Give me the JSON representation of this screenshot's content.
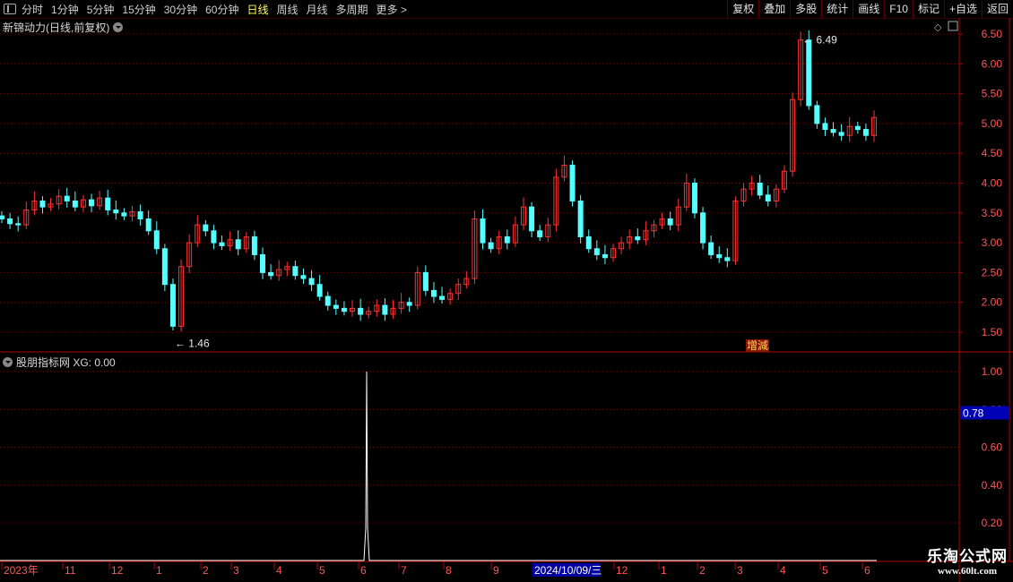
{
  "toolbar": {
    "periods": [
      "分时",
      "1分钟",
      "5分钟",
      "15分钟",
      "30分钟",
      "60分钟",
      "日线",
      "周线",
      "月线",
      "多周期",
      "更多 >"
    ],
    "active_period": "日线",
    "buttons": [
      "复权",
      "叠加",
      "多股",
      "统计",
      "画线",
      "F10",
      "标记",
      "+自选",
      "返回"
    ]
  },
  "main_pane": {
    "title": "新锦动力(日线,前复权)",
    "high_label": "6.49",
    "low_label": "1.46",
    "event_tag": "增減",
    "y_ticks": [
      "6.50",
      "6.00",
      "5.50",
      "5.00",
      "4.50",
      "4.00",
      "3.50",
      "3.00",
      "2.50",
      "2.00",
      "1.50"
    ]
  },
  "indicator_pane": {
    "title": "股朋指标网 XG: 0.00",
    "y_ticks": [
      "1.00",
      "0.80",
      "0.60",
      "0.40",
      "0.20"
    ],
    "current_value": "0.78"
  },
  "x_axis": {
    "labels": [
      "2023年",
      "11",
      "12",
      "1",
      "2",
      "3",
      "4",
      "5",
      "6",
      "7",
      "8",
      "9",
      "2024/10/09/三",
      "12",
      "1",
      "2",
      "3",
      "4",
      "5",
      "6"
    ]
  },
  "watermark": {
    "line1": "乐淘公式网",
    "line2": "www.60lt.com"
  },
  "colors": {
    "up": "#ff3232",
    "down": "#54ffff",
    "grid": "#6e0000",
    "axis": "#b00000"
  },
  "chart_data": [
    {
      "type": "candlestick",
      "title": "新锦动力(日线,前复权)",
      "ylim": [
        1.3,
        6.6
      ],
      "y_ticks": [
        6.5,
        6.0,
        5.5,
        5.0,
        4.5,
        4.0,
        3.5,
        3.0,
        2.5,
        2.0,
        1.5
      ],
      "annotations": [
        {
          "label": "6.49",
          "value": 6.49
        },
        {
          "label": "1.46",
          "value": 1.46
        }
      ],
      "x_labels": [
        "2023年",
        "11",
        "12",
        "1",
        "2",
        "3",
        "4",
        "5",
        "6",
        "7",
        "8",
        "9",
        "2024/10/09/三",
        "12",
        "1",
        "2",
        "3",
        "4",
        "5",
        "6"
      ],
      "close_path": [
        3.4,
        3.32,
        3.3,
        3.55,
        3.7,
        3.6,
        3.65,
        3.78,
        3.7,
        3.6,
        3.72,
        3.62,
        3.75,
        3.55,
        3.5,
        3.45,
        3.52,
        3.4,
        3.2,
        2.9,
        2.3,
        1.6,
        2.6,
        3.0,
        3.3,
        3.2,
        3.0,
        2.95,
        3.05,
        2.9,
        3.1,
        2.8,
        2.5,
        2.45,
        2.55,
        2.6,
        2.45,
        2.4,
        2.3,
        2.1,
        1.95,
        1.9,
        1.85,
        1.9,
        1.8,
        1.85,
        1.95,
        1.8,
        1.9,
        2.0,
        1.95,
        2.5,
        2.2,
        2.1,
        2.05,
        2.15,
        2.3,
        2.4,
        3.4,
        3.0,
        2.9,
        3.1,
        3.0,
        3.3,
        3.6,
        3.2,
        3.1,
        3.3,
        4.1,
        4.3,
        3.7,
        3.1,
        2.9,
        2.8,
        2.75,
        2.9,
        3.0,
        3.1,
        3.05,
        3.2,
        3.3,
        3.4,
        3.3,
        3.6,
        4.0,
        3.5,
        3.0,
        2.8,
        2.75,
        2.7,
        3.7,
        3.9,
        4.0,
        3.8,
        3.7,
        3.9,
        4.2,
        5.4,
        6.4,
        5.3,
        5.0,
        4.9,
        4.85,
        4.8,
        4.95,
        4.9,
        4.8,
        5.1
      ]
    },
    {
      "type": "line",
      "title": "股朋指标网 XG: 0.00",
      "ylim": [
        0,
        1.05
      ],
      "y_ticks": [
        1.0,
        0.8,
        0.6,
        0.4,
        0.2
      ],
      "signal_points": [
        {
          "x": "2024-06",
          "value": 1.0
        }
      ],
      "current_value": 0.78
    }
  ]
}
